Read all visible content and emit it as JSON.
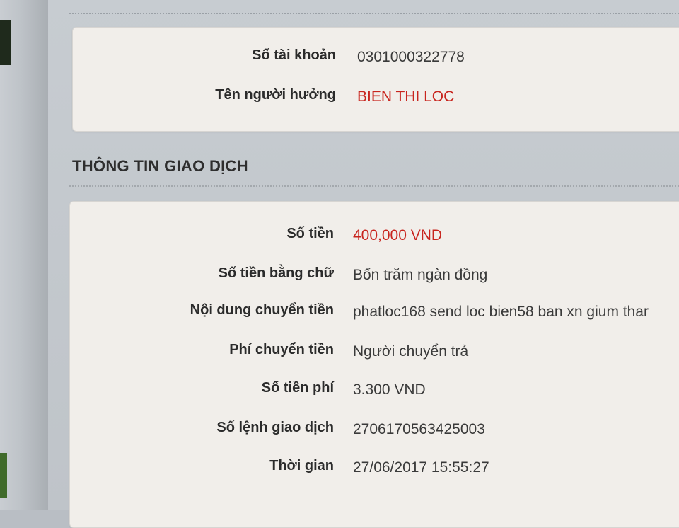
{
  "account": {
    "rows": [
      {
        "label": "Số tài khoản",
        "value": "0301000322778"
      },
      {
        "label": "Tên người hưởng",
        "value": "BIEN THI LOC"
      }
    ]
  },
  "transaction": {
    "title": "THÔNG TIN GIAO DỊCH",
    "rows": [
      {
        "label": "Số tiền",
        "value": "400,000 VND"
      },
      {
        "label": "Số tiền bằng chữ",
        "value": "Bốn trăm ngàn đồng"
      },
      {
        "label": "Nội dung chuyển tiền",
        "value": "phatloc168 send loc bien58 ban xn gium thar"
      },
      {
        "label": "Phí chuyển tiền",
        "value": "Người chuyển trả"
      },
      {
        "label": "Số tiền phí",
        "value": "3.300 VND"
      },
      {
        "label": "Số lệnh giao dịch",
        "value": "2706170563425003"
      },
      {
        "label": "Thời gian",
        "value": "27/06/2017 15:55:27"
      }
    ]
  },
  "colors": {
    "value_red": "#c8251e",
    "panel_bg": "#f1eeea",
    "page_bg": "#c7ccd1"
  }
}
